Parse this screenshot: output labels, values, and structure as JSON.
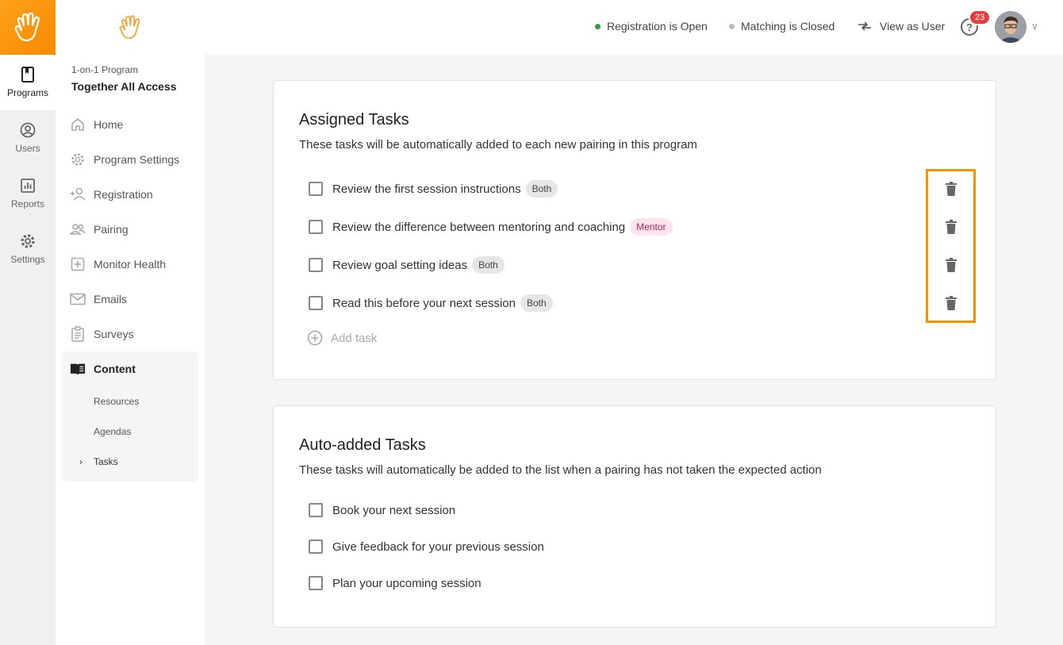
{
  "rail": {
    "items": [
      {
        "label": "Programs",
        "icon": "book-icon",
        "active": true
      },
      {
        "label": "Users",
        "icon": "user-circle-icon"
      },
      {
        "label": "Reports",
        "icon": "bar-chart-icon"
      },
      {
        "label": "Settings",
        "icon": "gear-icon"
      }
    ]
  },
  "sidebar": {
    "program_caption": "1-on-1 Program",
    "program_name": "Together All Access",
    "items": [
      {
        "label": "Home",
        "icon": "home-icon"
      },
      {
        "label": "Program Settings",
        "icon": "gear-icon"
      },
      {
        "label": "Registration",
        "icon": "add-person-icon"
      },
      {
        "label": "Pairing",
        "icon": "people-icon"
      },
      {
        "label": "Monitor Health",
        "icon": "plus-box-icon"
      },
      {
        "label": "Emails",
        "icon": "mail-icon"
      },
      {
        "label": "Surveys",
        "icon": "clipboard-icon"
      }
    ],
    "content": {
      "label": "Content",
      "icon": "open-book-icon",
      "sub_items": [
        "Resources",
        "Agendas",
        "Tasks"
      ]
    }
  },
  "topbar": {
    "registration_status": "Registration is Open",
    "matching_status": "Matching is Closed",
    "view_as_user": "View as User",
    "help_badge": "23",
    "colors": {
      "open": "#2e9e44",
      "closed": "#bbbbbb",
      "badge": "#e53e3e"
    }
  },
  "assigned": {
    "title": "Assigned Tasks",
    "description": "These tasks will be automatically added to each new pairing in this program",
    "tasks": [
      {
        "label": "Review the first session instructions",
        "tag": "Both"
      },
      {
        "label": "Review the difference between mentoring and coaching",
        "tag": "Mentor"
      },
      {
        "label": "Review goal setting ideas",
        "tag": "Both"
      },
      {
        "label": "Read this before your next session",
        "tag": "Both"
      }
    ],
    "add_label": "Add task"
  },
  "auto": {
    "title": "Auto-added Tasks",
    "description": "These tasks will automatically be added to the list when a pairing has not taken the expected action",
    "tasks": [
      {
        "label": "Book your next session"
      },
      {
        "label": "Give feedback for your previous session"
      },
      {
        "label": "Plan your upcoming session"
      }
    ]
  },
  "theme": {
    "accent": "#f29400",
    "brand_orange": "#ffa11a"
  }
}
